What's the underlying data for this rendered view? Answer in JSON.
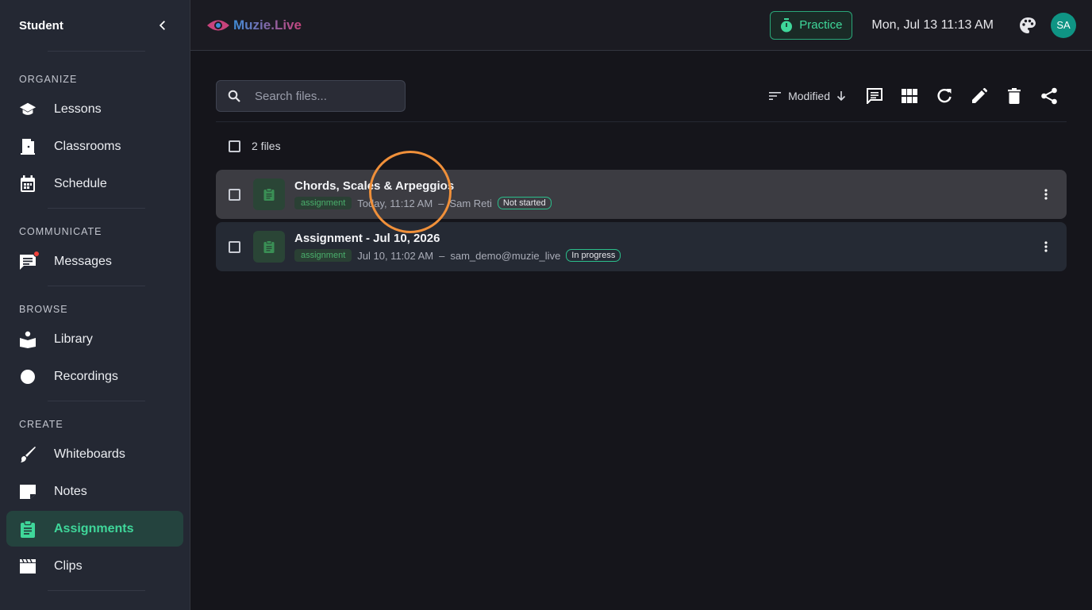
{
  "sidebar": {
    "title": "Student",
    "sections": [
      {
        "label": "ORGANIZE",
        "items": [
          {
            "label": "Lessons"
          },
          {
            "label": "Classrooms"
          },
          {
            "label": "Schedule"
          }
        ]
      },
      {
        "label": "COMMUNICATE",
        "items": [
          {
            "label": "Messages"
          }
        ]
      },
      {
        "label": "BROWSE",
        "items": [
          {
            "label": "Library"
          },
          {
            "label": "Recordings"
          }
        ]
      },
      {
        "label": "CREATE",
        "items": [
          {
            "label": "Whiteboards"
          },
          {
            "label": "Notes"
          },
          {
            "label": "Assignments"
          },
          {
            "label": "Clips"
          }
        ]
      }
    ],
    "active_item": "Assignments"
  },
  "header": {
    "brand": "Muzie.Live",
    "practice_label": "Practice",
    "datetime": "Mon, Jul 13 11:13 AM",
    "avatar_initials": "SA"
  },
  "toolbar": {
    "search_placeholder": "Search files...",
    "sort_label": "Modified"
  },
  "files": {
    "count_label": "2 files",
    "rows": [
      {
        "name": "Chords, Scales & Arpeggios",
        "type": "assignment",
        "date": "Today, 11:12 AM",
        "sep": "–",
        "owner": "Sam Reti",
        "status": "Not started"
      },
      {
        "name": "Assignment - Jul 10, 2026",
        "type": "assignment",
        "date": "Jul 10, 11:02 AM",
        "sep": "–",
        "owner": "sam_demo@muzie_live",
        "status": "In progress"
      }
    ]
  },
  "colors": {
    "accent": "#3fd79a",
    "sidebar_bg": "#242833",
    "main_bg": "#15151b",
    "avatar_bg": "#0f9484",
    "cursor_ring": "#f0903a"
  }
}
